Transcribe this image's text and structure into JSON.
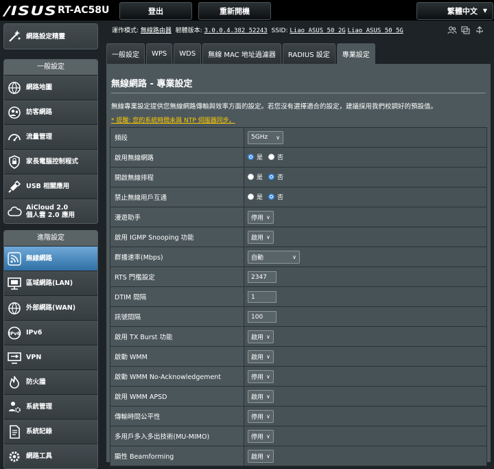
{
  "header": {
    "logo": "/ISUS",
    "model": "RT-AC58U",
    "logout": "登出",
    "reboot": "重新開機",
    "language": "繁體中文",
    "op_mode_label": "運作模式:",
    "op_mode_value": "無線路由器",
    "firmware_label": "韌體版本:",
    "firmware_value": "3.0.0.4.382_52243",
    "ssid_label": "SSID:",
    "ssid_2g": "Liao_ASUS_50_2G",
    "ssid_5g": "Liao_ASUS_50_5G"
  },
  "sidebar": {
    "wizard": "網路設定精靈",
    "general_header": "一般設定",
    "general_items": [
      "網路地圖",
      "訪客網路",
      "流量管理",
      "家長電腦控制程式",
      "USB 相關應用",
      "AiCloud 2.0",
      "個人雲 2.0 應用"
    ],
    "advanced_header": "進階設定",
    "advanced_items": [
      "無線網路",
      "區域網路(LAN)",
      "外部網路(WAN)",
      "IPv6",
      "VPN",
      "防火牆",
      "系統管理",
      "系統記錄",
      "網路工具"
    ]
  },
  "tabs": [
    "一般設定",
    "WPS",
    "WDS",
    "無線 MAC 地址過濾器",
    "RADIUS 設定",
    "專業設定"
  ],
  "page": {
    "title": "無線網路 - 專業設定",
    "description": "無線專業設定提供您無線網路傳輸與效率方面的設定。若您沒有選擇適合的設定，建議採用我們校調好的預設值。",
    "hint": "* 提醒: 您的系統時間未與 NTP 伺服器同步。"
  },
  "radio": {
    "yes": "是",
    "no": "否"
  },
  "settings": [
    {
      "label": "頻段",
      "value": "5GHz"
    },
    {
      "label": "啟用無線網路"
    },
    {
      "label": "開啟無線排程"
    },
    {
      "label": "禁止無線用戶互通"
    },
    {
      "label": "漫遊助手",
      "value": "停用"
    },
    {
      "label": "啟用 IGMP Snooping 功能",
      "value": "啟用"
    },
    {
      "label": "群播速率(Mbps)",
      "value": "自動"
    },
    {
      "label": "RTS 門檻設定",
      "value": "2347"
    },
    {
      "label": "DTIM 間隔",
      "value": "1"
    },
    {
      "label": "訊號間隔",
      "value": "100"
    },
    {
      "label": "啟用 TX Burst 功能",
      "value": "啟用"
    },
    {
      "label": "啟動 WMM",
      "value": "啟用"
    },
    {
      "label": "啟動 WMM No-Acknowledgement",
      "value": "停用"
    },
    {
      "label": "啟用 WMM APSD",
      "value": "啟用"
    },
    {
      "label": "傳輸時間公平性",
      "value": "停用"
    },
    {
      "label": "多用戶多入多出技術(MU-MIMO)",
      "value": "停用"
    },
    {
      "label": "顯性 Beamforming",
      "value": "啟用"
    }
  ]
}
